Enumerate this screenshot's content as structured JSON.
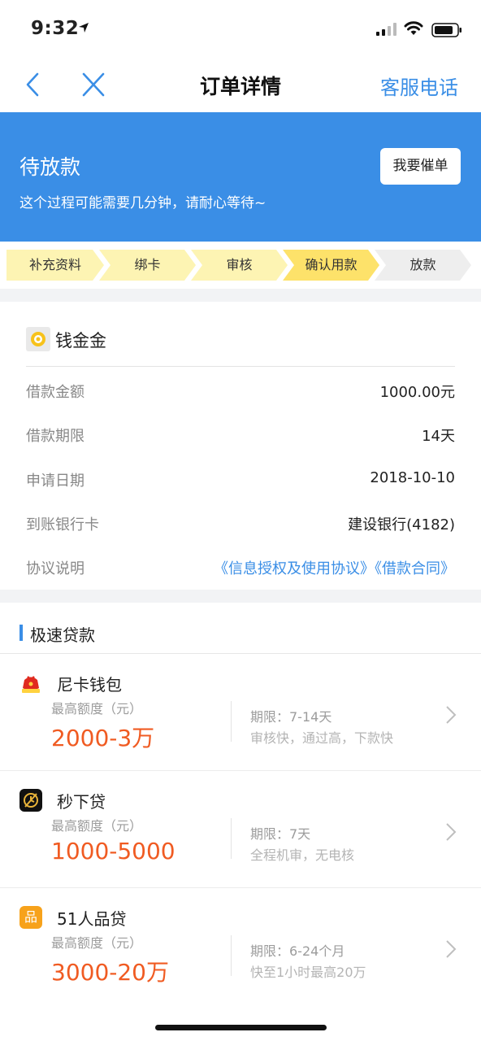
{
  "status_bar": {
    "time": "9:32"
  },
  "nav": {
    "title": "订单详情",
    "service_label": "客服电话"
  },
  "banner": {
    "status_title": "待放款",
    "status_desc": "这个过程可能需要几分钟，请耐心等待~",
    "urge_label": "我要催单"
  },
  "steps": [
    {
      "label": "补充资料",
      "state": "done"
    },
    {
      "label": "绑卡",
      "state": "done"
    },
    {
      "label": "审核",
      "state": "done"
    },
    {
      "label": "确认用款",
      "state": "current"
    },
    {
      "label": "放款",
      "state": "pending"
    }
  ],
  "detail": {
    "lender": "钱金金",
    "rows": [
      {
        "label": "借款金额",
        "value": "1000.00元"
      },
      {
        "label": "借款期限",
        "value": "14天"
      },
      {
        "label": "申请日期",
        "value": "2018-10-10"
      },
      {
        "label": "到账银行卡",
        "value": "建设银行(4182)"
      }
    ],
    "agreement_label": "协议说明",
    "agreement_links": "《信息授权及使用协议》《借款合同》"
  },
  "quick_loans": {
    "section_title": "极速贷款",
    "items": [
      {
        "name": "尼卡钱包",
        "limit_label": "最高额度（元）",
        "limit": "2000-3万",
        "term": "期限：7-14天",
        "features": "审核快，通过高，下款快",
        "icon": "red-bag-icon"
      },
      {
        "name": "秒下贷",
        "limit_label": "最高额度（元）",
        "limit": "1000-5000",
        "term": "期限：7天",
        "features": "全程机审，无电核",
        "icon": "clock-arrow-icon"
      },
      {
        "name": "51人品贷",
        "limit_label": "最高额度（元）",
        "limit": "3000-20万",
        "term": "期限：6-24个月",
        "features": "快至1小时最高20万",
        "icon": "pin-logo-icon",
        "icon_text": "品"
      }
    ]
  },
  "colors": {
    "accent": "#3a8ee6",
    "highlight": "#f05b22",
    "step_done": "#fdf4b3",
    "step_current": "#fde26a",
    "step_pending": "#eeeeee"
  }
}
